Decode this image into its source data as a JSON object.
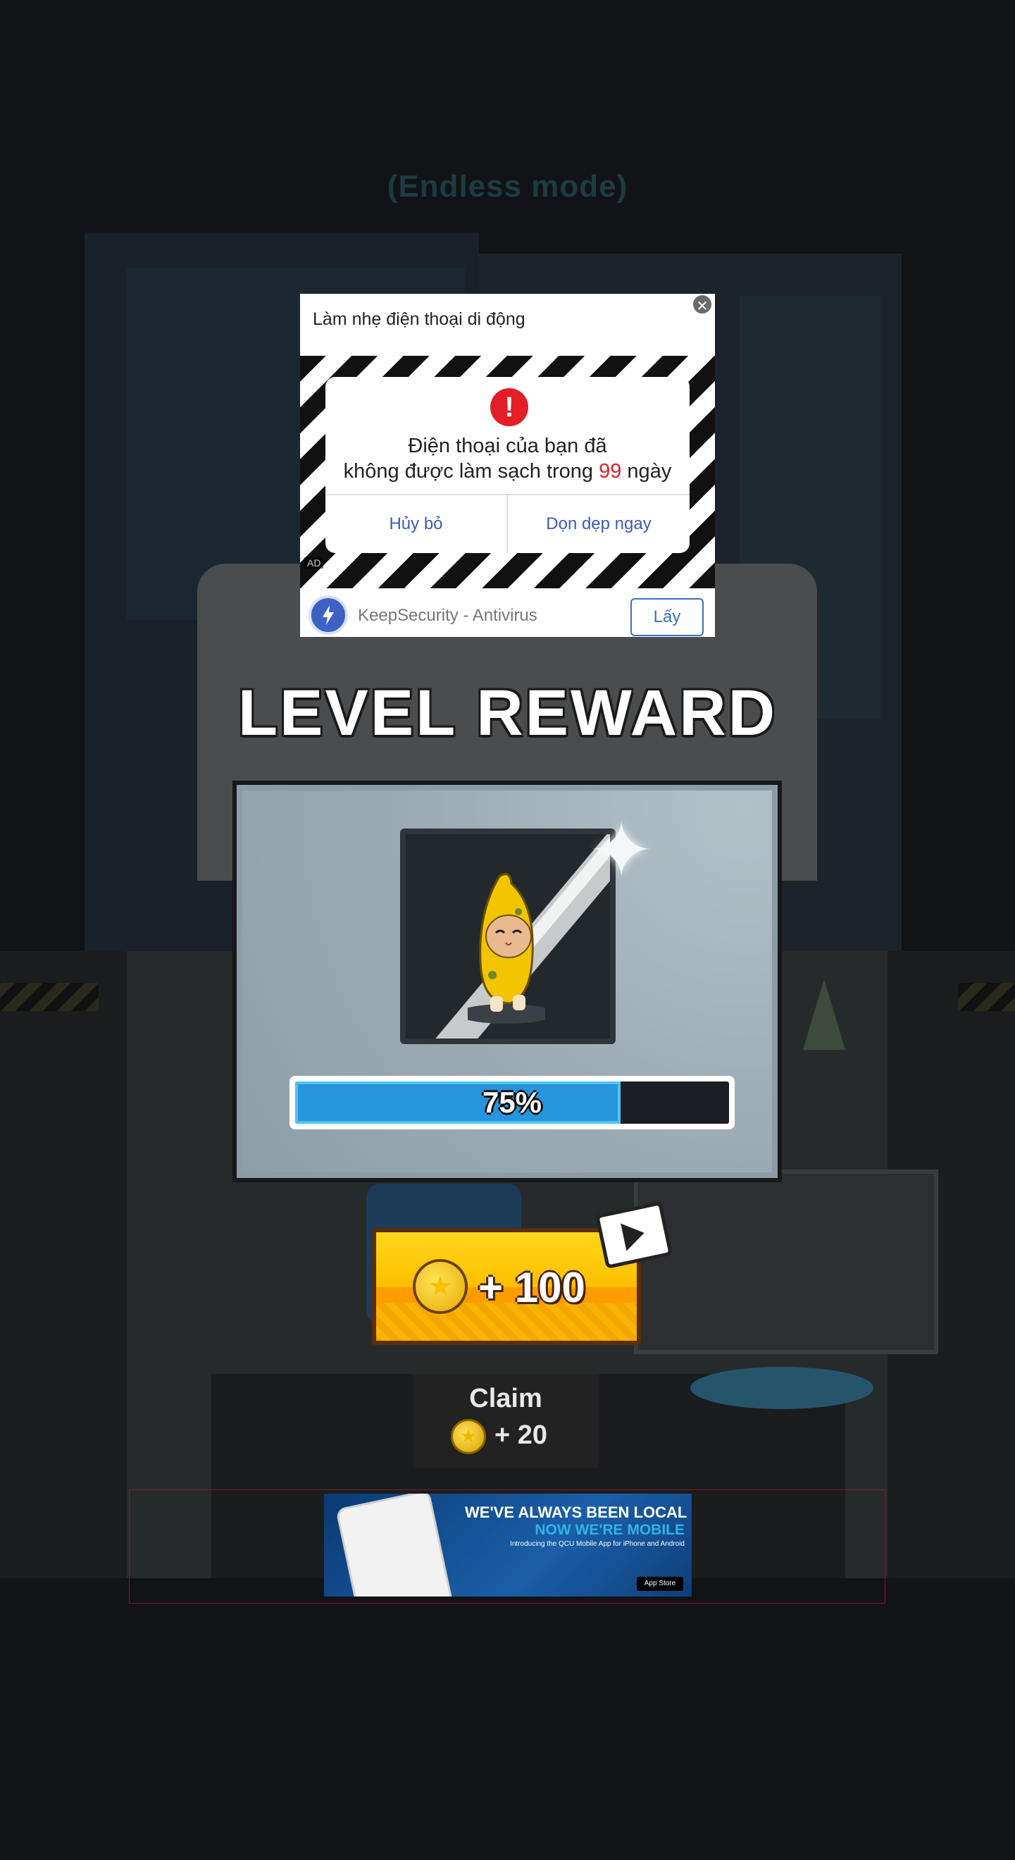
{
  "game": {
    "mode_title": "(Endless mode)",
    "reward_title": "LEVEL REWARD",
    "progress": {
      "percent": 75,
      "label": "75%"
    },
    "watch_reward": {
      "amount_label": "+ 100",
      "icon": "video-play-icon"
    },
    "claim": {
      "label": "Claim",
      "amount_label": "+ 20"
    },
    "colors": {
      "progress_fill": "#2794de",
      "button_gold": "#ffc400",
      "title_white": "#ffffff"
    }
  },
  "ad": {
    "title": "Làm nhẹ điện thoại di động",
    "message_line1": "Điện thoại của bạn đã",
    "message_line2_prefix": "không được làm sạch trong ",
    "message_days": "99",
    "message_line2_suffix": " ngày",
    "cancel_label": "Hủy bỏ",
    "clean_label": "Dọn dẹp ngay",
    "app_name": "KeepSecurity - Antivirus",
    "cta_label": "Lấy",
    "ad_tag": "AD"
  },
  "banner": {
    "line1": "WE'VE ALWAYS BEEN LOCAL",
    "line2": "NOW WE'RE MOBILE",
    "line3": "Introducing the QCU Mobile App for iPhone and Android",
    "store_badge": "App Store"
  }
}
